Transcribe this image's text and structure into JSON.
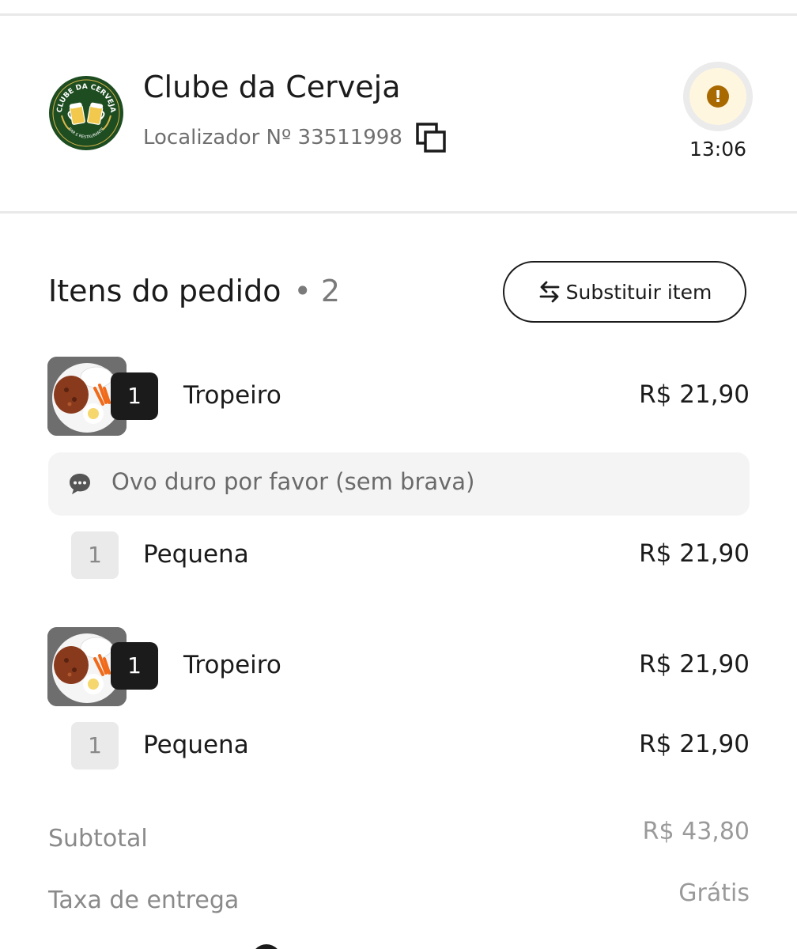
{
  "store": {
    "name": "Clube da Cerveja",
    "locator": "Localizador Nº 33511998",
    "logo_icon": "beer-mugs-logo",
    "logo_text_top": "CLUBE DA CERVEJA",
    "logo_text_bottom": "BAR E RESTAURANTE"
  },
  "status": {
    "icon": "exclamation-icon",
    "time": "13:06",
    "accent_color": "#a86a00"
  },
  "items_section": {
    "title": "Itens do pedido",
    "dot": "•",
    "count": "2",
    "replace_button_label": "Substituir item",
    "replace_icon": "swap-arrows-icon"
  },
  "items": [
    {
      "quantity": "1",
      "name": "Tropeiro",
      "price": "R$ 21,90",
      "note": "Ovo duro por favor (sem brava)",
      "options": [
        {
          "quantity": "1",
          "name": "Pequena",
          "price": "R$ 21,90"
        }
      ]
    },
    {
      "quantity": "1",
      "name": "Tropeiro",
      "price": "R$ 21,90",
      "options": [
        {
          "quantity": "1",
          "name": "Pequena",
          "price": "R$ 21,90"
        }
      ]
    }
  ],
  "summary": {
    "subtotal_label": "Subtotal",
    "subtotal_value": "R$ 43,80",
    "delivery_label": "Taxa de entrega",
    "delivery_value": "Grátis"
  }
}
